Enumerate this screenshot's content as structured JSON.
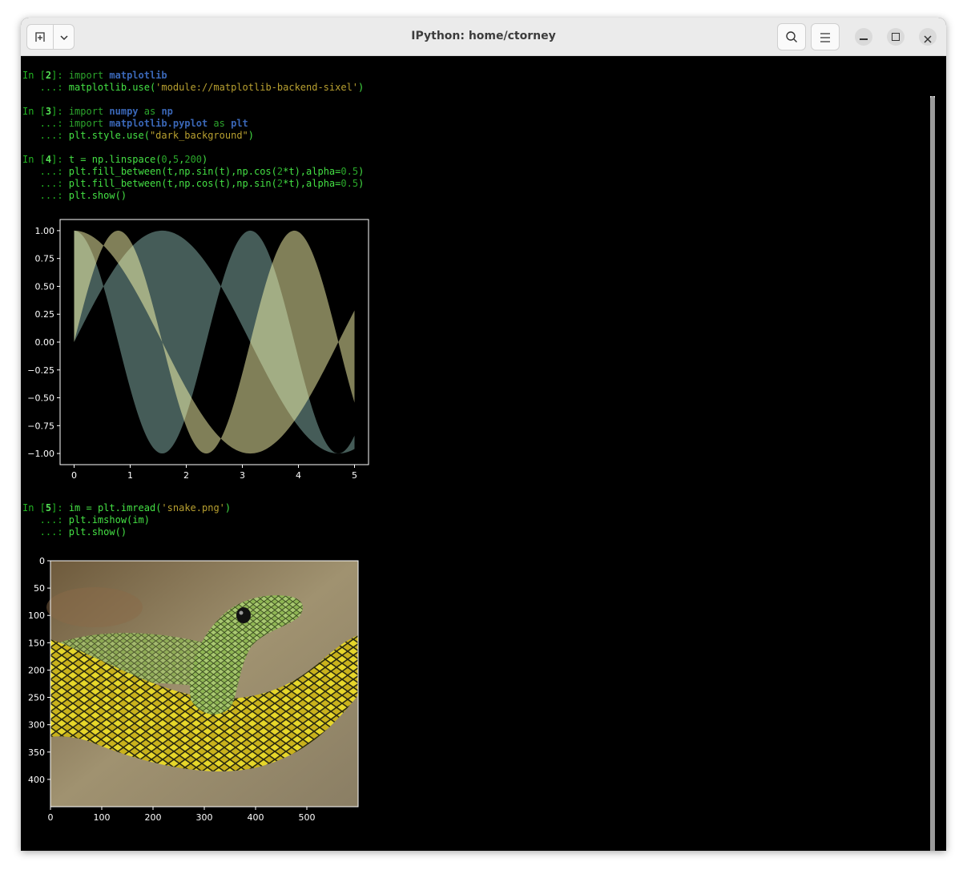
{
  "window": {
    "title": "IPython: home/ctorney",
    "buttons": [
      "new-tab",
      "tab-menu",
      "search",
      "menu",
      "minimize",
      "maximize",
      "close"
    ]
  },
  "cells": {
    "c2": {
      "prompt_num": "2",
      "l1": "import matplotlib",
      "l2": "matplotlib.use('module://matplotlib-backend-sixel')"
    },
    "c3": {
      "prompt_num": "3",
      "l1": "import numpy as np",
      "l2": "import matplotlib.pyplot as plt",
      "l3": "plt.style.use(\"dark_background\")"
    },
    "c4": {
      "prompt_num": "4",
      "l1": "t = np.linspace(0,5,200)",
      "l2": "plt.fill_between(t,np.sin(t),np.cos(2*t),alpha=0.5)",
      "l3": "plt.fill_between(t,np.cos(t),np.sin(2*t),alpha=0.5)",
      "l4": "plt.show()"
    },
    "c5": {
      "prompt_num": "5",
      "l1": "im = plt.imread('snake.png')",
      "l2": "plt.imshow(im)",
      "l3": "plt.show()"
    }
  },
  "prompt_in": "In [",
  "prompt_cont": "   ...: ",
  "chart_data": [
    {
      "type": "area",
      "title": "",
      "xlabel": "",
      "ylabel": "",
      "xlim": [
        -0.25,
        5.25
      ],
      "ylim": [
        -1.1,
        1.1
      ],
      "x_ticks": [
        0,
        1,
        2,
        3,
        4,
        5
      ],
      "y_ticks": [
        1.0,
        0.75,
        0.5,
        0.25,
        0.0,
        -0.25,
        -0.5,
        -0.75,
        -1.0
      ],
      "y_tick_labels": [
        "1.00",
        "0.75",
        "0.50",
        "0.25",
        "0.00",
        "−0.25",
        "−0.50",
        "−0.75",
        "−1.00"
      ],
      "series": [
        {
          "expr_upper": "sin(t)",
          "expr_lower": "cos(2t)",
          "color": "#8ab8b0",
          "alpha": 0.5
        },
        {
          "expr_upper": "cos(t)",
          "expr_lower": "sin(2t)",
          "color": "#fffeb0",
          "alpha": 0.5
        }
      ],
      "x_range": [
        0,
        5
      ],
      "points": 200
    },
    {
      "type": "image",
      "x_ticks": [
        0,
        100,
        200,
        300,
        400,
        500
      ],
      "y_ticks": [
        0,
        50,
        100,
        150,
        200,
        250,
        300,
        350,
        400
      ],
      "xlim": [
        0,
        600
      ],
      "ylim": [
        450,
        0
      ]
    }
  ]
}
